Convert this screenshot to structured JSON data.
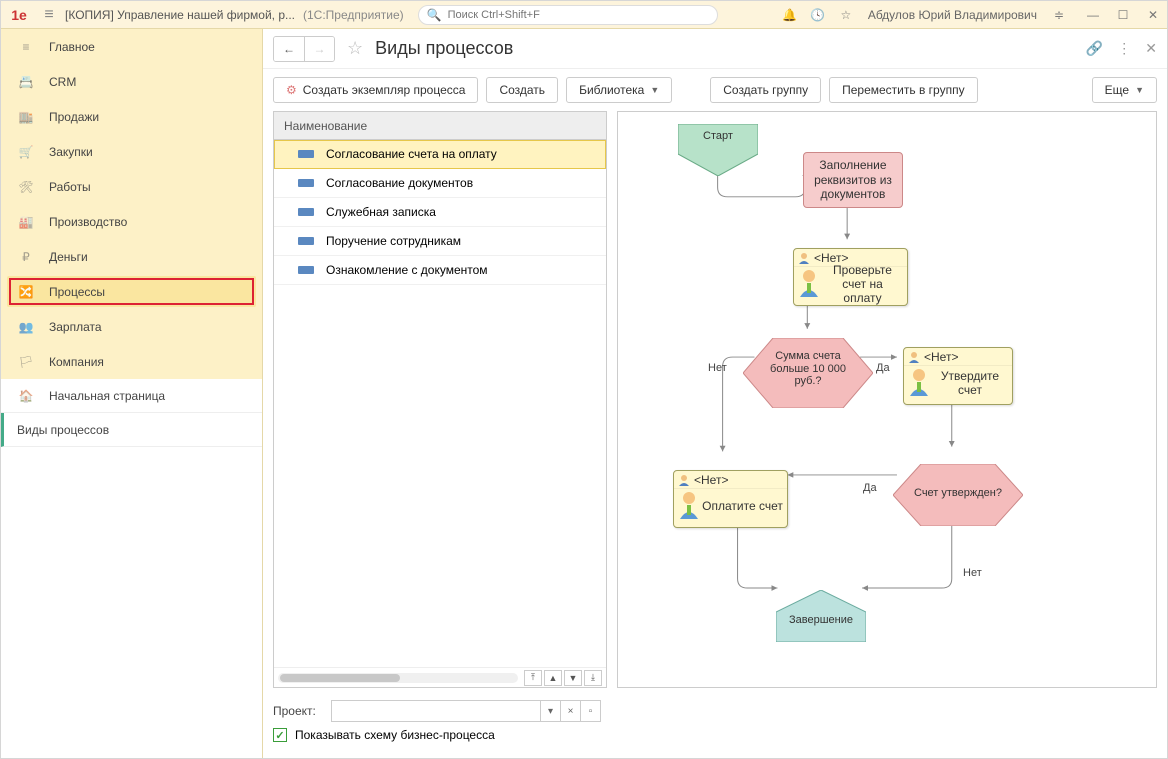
{
  "titlebar": {
    "title_prefix": "[КОПИЯ] Управление нашей фирмой, р...",
    "title_suffix": "(1С:Предприятие)",
    "search_placeholder": "Поиск Ctrl+Shift+F",
    "username": "Абдулов Юрий Владимирович"
  },
  "sidebar": {
    "items": [
      {
        "label": "Главное",
        "icon": "menu-icon"
      },
      {
        "label": "CRM",
        "icon": "crm-icon"
      },
      {
        "label": "Продажи",
        "icon": "sales-icon"
      },
      {
        "label": "Закупки",
        "icon": "purchase-icon"
      },
      {
        "label": "Работы",
        "icon": "works-icon"
      },
      {
        "label": "Производство",
        "icon": "production-icon"
      },
      {
        "label": "Деньги",
        "icon": "money-icon"
      },
      {
        "label": "Процессы",
        "icon": "processes-icon",
        "selected": true
      },
      {
        "label": "Зарплата",
        "icon": "salary-icon"
      },
      {
        "label": "Компания",
        "icon": "company-icon"
      }
    ],
    "extra": [
      {
        "label": "Начальная страница",
        "icon": "home-icon"
      },
      {
        "label": "Виды процессов",
        "active": true
      }
    ]
  },
  "page": {
    "title": "Виды процессов"
  },
  "toolbar": {
    "create_instance": "Создать экземпляр процесса",
    "create": "Создать",
    "library": "Библиотека",
    "create_group": "Создать группу",
    "move_to_group": "Переместить в группу",
    "more": "Еще"
  },
  "list": {
    "header": "Наименование",
    "rows": [
      "Согласование счета на оплату",
      "Согласование документов",
      "Служебная записка",
      "Поручение сотрудникам",
      "Ознакомление с документом"
    ],
    "selected_index": 0
  },
  "diagram": {
    "start": "Старт",
    "fill_req": "Заполнение реквизитов из документов",
    "assignee_none": "<Нет>",
    "check_invoice": "Проверьте счет на оплату",
    "sum_condition": "Сумма счета больше 10 000 руб.?",
    "yes": "Да",
    "no": "Нет",
    "approve_invoice": "Утвердите счет",
    "approved_q": "Счет утвержден?",
    "pay_invoice": "Оплатите счет",
    "finish": "Завершение"
  },
  "footer": {
    "project_label": "Проект:",
    "show_schema": "Показывать схему бизнес-процесса"
  }
}
